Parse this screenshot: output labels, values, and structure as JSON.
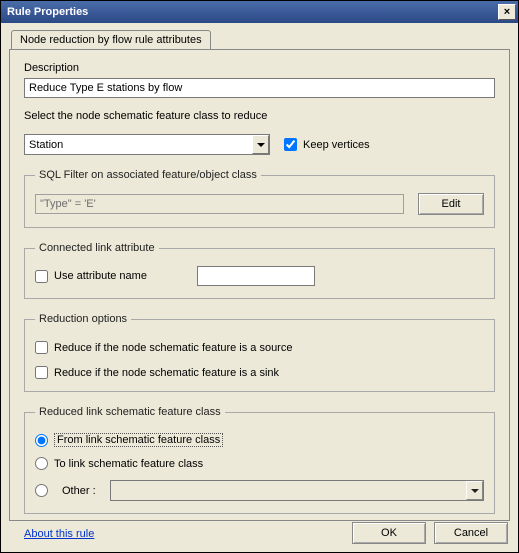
{
  "window": {
    "title": "Rule Properties",
    "close_icon": "×"
  },
  "tab": {
    "label": "Node reduction by flow rule attributes"
  },
  "description": {
    "label": "Description",
    "value": "Reduce Type E stations by flow"
  },
  "feature_class": {
    "label": "Select the node schematic feature class to reduce",
    "selected": "Station",
    "keep_vertices_label": "Keep vertices",
    "keep_vertices_checked": true
  },
  "sql_filter": {
    "legend": "SQL Filter on associated feature/object class",
    "value": "\"Type\" = 'E'",
    "edit_label": "Edit"
  },
  "connected_link": {
    "legend": "Connected link attribute",
    "use_attr_label": "Use attribute name",
    "use_attr_checked": false,
    "attr_value": ""
  },
  "reduction_options": {
    "legend": "Reduction options",
    "source_label": "Reduce if the node schematic feature is a source",
    "source_checked": false,
    "sink_label": "Reduce if the node schematic feature is a sink",
    "sink_checked": false
  },
  "reduced_link": {
    "legend": "Reduced link schematic feature class",
    "from_label": "From link schematic feature class",
    "to_label": "To link schematic feature class",
    "other_label": "Other :",
    "other_value": "",
    "selected": "from"
  },
  "link": {
    "about": "About this rule"
  },
  "buttons": {
    "ok": "OK",
    "cancel": "Cancel"
  }
}
